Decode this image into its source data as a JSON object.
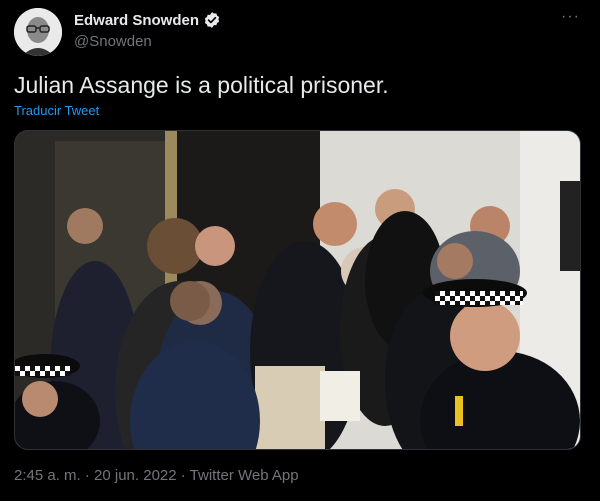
{
  "tweet": {
    "author_name": "Edward Snowden",
    "handle": "@Snowden",
    "more_label": "···",
    "text": "Julian Assange is a political prisoner.",
    "translate_label": "Traducir Tweet",
    "timestamp": "2:45 a. m. · 20 jun. 2022 · Twitter Web App"
  },
  "icons": {
    "verified": "verified-badge-icon",
    "more": "more-options-icon"
  },
  "colors": {
    "background": "#000000",
    "text": "#e7e9ea",
    "secondary": "#71767b",
    "link": "#1d9bf0"
  }
}
